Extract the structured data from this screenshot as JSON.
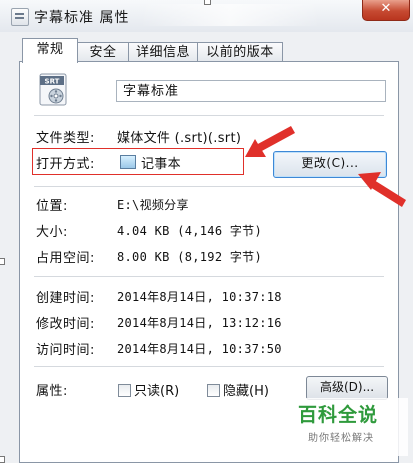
{
  "window": {
    "title": "字幕标准 属性",
    "close_label": "✕"
  },
  "tabs": [
    {
      "label": "常规",
      "active": true
    },
    {
      "label": "安全",
      "active": false
    },
    {
      "label": "详细信息",
      "active": false
    },
    {
      "label": "以前的版本",
      "active": false
    }
  ],
  "file": {
    "icon_text": "SRT",
    "name": "字幕标准"
  },
  "rows": {
    "type_label": "文件类型:",
    "type_value": "媒体文件 (.srt)(.srt)",
    "opens_label": "打开方式:",
    "opens_value": "记事本",
    "change_button": "更改(C)...",
    "location_label": "位置:",
    "location_value": "E:\\视频分享",
    "size_label": "大小:",
    "size_value": "4.04 KB (4,146 字节)",
    "disk_label": "占用空间:",
    "disk_value": "8.00 KB (8,192 字节)",
    "created_label": "创建时间:",
    "created_value": "2014年8月14日, 10:37:18",
    "modified_label": "修改时间:",
    "modified_value": "2014年8月14日, 13:12:16",
    "accessed_label": "访问时间:",
    "accessed_value": "2014年8月14日, 10:37:50"
  },
  "attributes": {
    "label": "属性:",
    "readonly_label": "只读(R)",
    "hidden_label": "隐藏(H)",
    "advanced_button": "高级(D)..."
  },
  "watermark": {
    "title": "百科全说",
    "subtitle": "助你轻松解决"
  },
  "colors": {
    "highlight": "#e0302a",
    "button_focus": "#3d88d6",
    "watermark": "#2f9a3c"
  }
}
